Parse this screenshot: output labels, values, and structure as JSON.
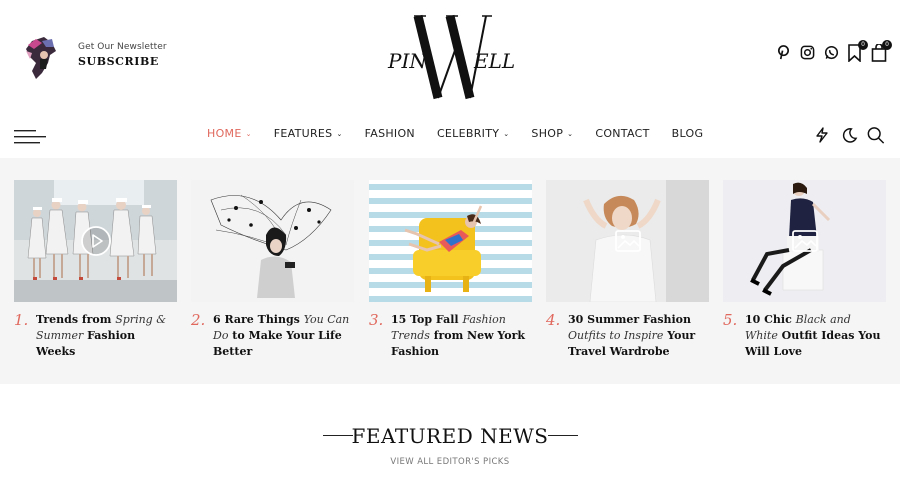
{
  "newsletter": {
    "kicker": "Get Our Newsletter",
    "title": "SUBSCRIBE"
  },
  "brand": {
    "logo_letters": [
      "PIN",
      "W",
      "ELL"
    ]
  },
  "header_icons": {
    "social": [
      "pinterest-icon",
      "instagram-icon",
      "whatsapp-icon"
    ],
    "bookmark_count": "0",
    "cart_count": "0"
  },
  "nav": {
    "items": [
      {
        "label": "HOME",
        "dropdown": true,
        "active": true
      },
      {
        "label": "FEATURES",
        "dropdown": true,
        "active": false
      },
      {
        "label": "FASHION",
        "dropdown": false,
        "active": false
      },
      {
        "label": "CELEBRITY",
        "dropdown": true,
        "active": false
      },
      {
        "label": "SHOP",
        "dropdown": true,
        "active": false
      },
      {
        "label": "CONTACT",
        "dropdown": false,
        "active": false
      },
      {
        "label": "BLOG",
        "dropdown": false,
        "active": false
      }
    ],
    "dropdown_glyph": "⌄",
    "right_icons": [
      "lightning-icon",
      "dark-mode-moon-icon",
      "search-icon"
    ]
  },
  "trending": [
    {
      "num": "1.",
      "parts": [
        {
          "t": "Trends from ",
          "i": false
        },
        {
          "t": "Spring & Summer",
          "i": true
        },
        {
          "t": " Fashion Weeks",
          "i": false
        }
      ],
      "media": "video-play-icon"
    },
    {
      "num": "2.",
      "parts": [
        {
          "t": "6 Rare Things ",
          "i": false
        },
        {
          "t": "You Can Do",
          "i": true
        },
        {
          "t": " to Make Your Life Better",
          "i": false
        }
      ],
      "media": ""
    },
    {
      "num": "3.",
      "parts": [
        {
          "t": "15 Top Fall ",
          "i": false
        },
        {
          "t": "Fashion Trends",
          "i": true
        },
        {
          "t": " from New York Fashion",
          "i": false
        }
      ],
      "media": ""
    },
    {
      "num": "4.",
      "parts": [
        {
          "t": "30 Summer Fashion ",
          "i": false
        },
        {
          "t": "Outfits to Inspire",
          "i": true
        },
        {
          "t": " Your Travel Wardrobe",
          "i": false
        }
      ],
      "media": "gallery-icon"
    },
    {
      "num": "5.",
      "parts": [
        {
          "t": "10 Chic ",
          "i": false
        },
        {
          "t": "Black and White",
          "i": true
        },
        {
          "t": " Outfit Ideas You Will Love",
          "i": false
        }
      ],
      "media": "gallery-icon"
    }
  ],
  "featured": {
    "title": "FEATURED NEWS",
    "subtitle": "VIEW ALL EDITOR'S PICKS"
  },
  "colors": {
    "accent": "#e0685d",
    "strip_bg": "#f5f5f5",
    "text": "#111111"
  }
}
